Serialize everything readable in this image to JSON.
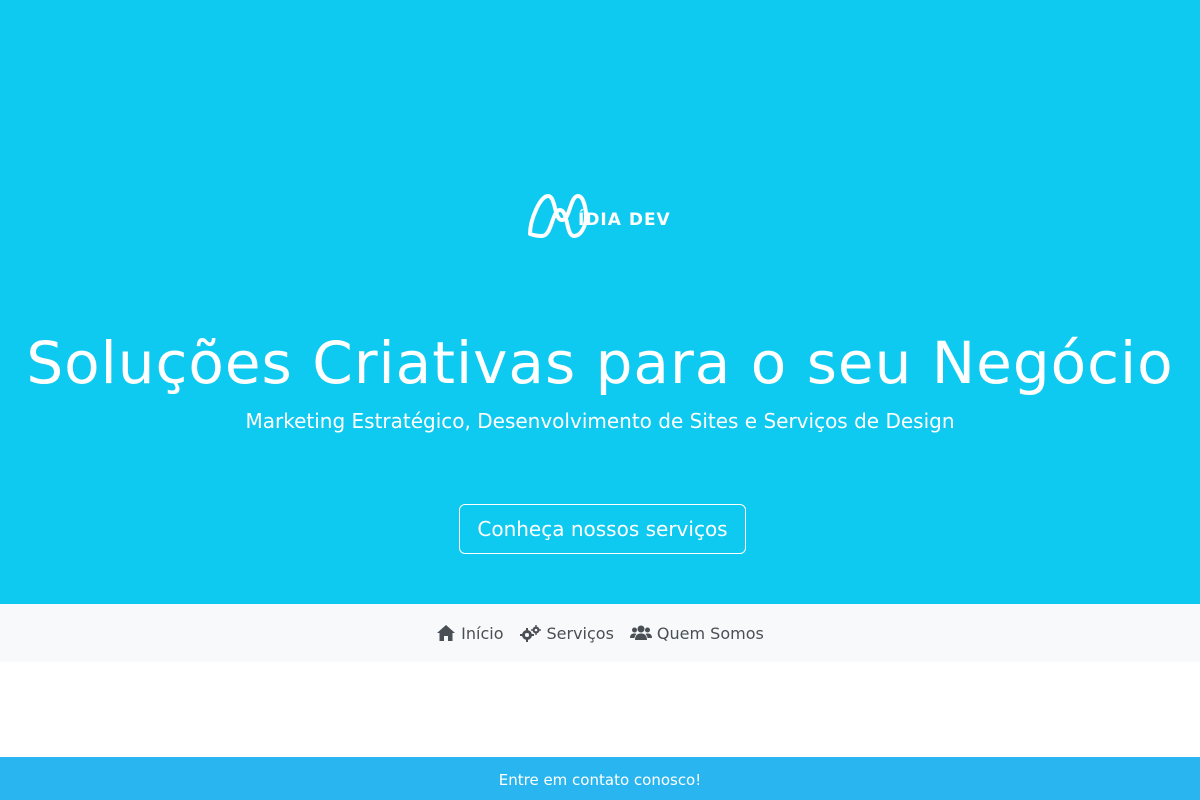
{
  "hero": {
    "logo_text": "ÍDIA DEV",
    "title": "Soluções Criativas para o seu Negócio",
    "subtitle": "Marketing Estratégico, Desenvolvimento de Sites e Serviços de Design",
    "cta_label": "Conheça nossos serviços",
    "background_color": "#0ecaf0"
  },
  "nav": {
    "items": [
      {
        "label": "Início",
        "icon": "home-icon"
      },
      {
        "label": "Serviços",
        "icon": "gears-icon"
      },
      {
        "label": "Quem Somos",
        "icon": "users-icon"
      }
    ]
  },
  "footer": {
    "text": "Entre em contato conosco!",
    "background_color": "#29b6f0"
  }
}
